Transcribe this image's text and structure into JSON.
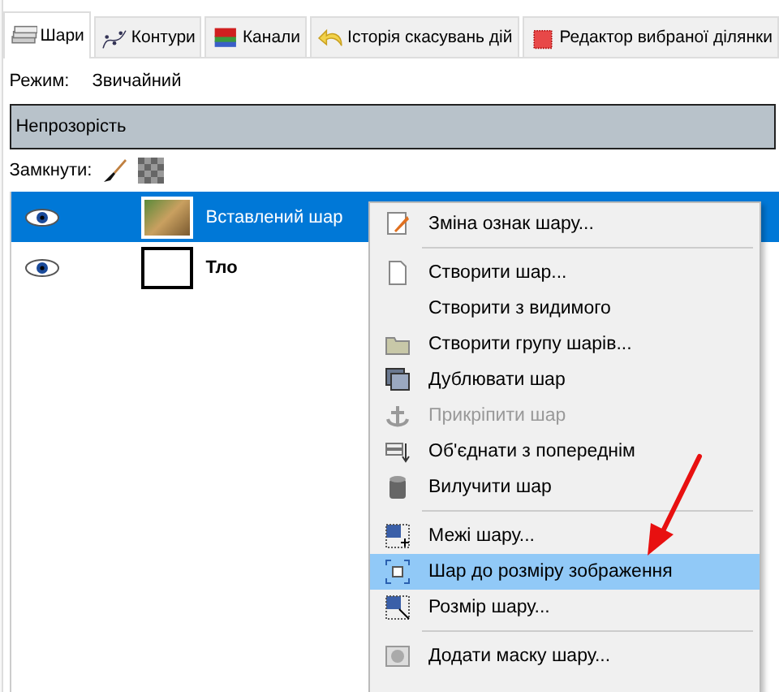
{
  "tabs": [
    {
      "label": "Шари",
      "selected": true
    },
    {
      "label": "Контури",
      "selected": false
    },
    {
      "label": "Канали",
      "selected": false
    },
    {
      "label": "Історія скасувань дій",
      "selected": false
    },
    {
      "label": "Редактор вибраної ділянки",
      "selected": false
    }
  ],
  "mode": {
    "label": "Режим:",
    "value": "Звичайний"
  },
  "opacity": {
    "label": "Непрозорість",
    "level": 1
  },
  "lock": {
    "label": "Замкнути:"
  },
  "layers": [
    {
      "name": "Вставлений шар",
      "visible": true,
      "selected": true
    },
    {
      "name": "Тло",
      "visible": true,
      "selected": false
    }
  ],
  "context_menu": {
    "items": [
      {
        "kind": "item",
        "label": "Зміна ознак шару...",
        "disabled": false,
        "selected": false
      },
      {
        "kind": "separator"
      },
      {
        "kind": "item",
        "label": "Створити шар...",
        "disabled": false,
        "selected": false
      },
      {
        "kind": "item",
        "label": "Створити з видимого",
        "disabled": false,
        "selected": false
      },
      {
        "kind": "item",
        "label": "Створити групу шарів...",
        "disabled": false,
        "selected": false
      },
      {
        "kind": "item",
        "label": "Дублювати шар",
        "disabled": false,
        "selected": false
      },
      {
        "kind": "item",
        "label": "Прикріпити шар",
        "disabled": true,
        "selected": false
      },
      {
        "kind": "item",
        "label": "Об'єднати з попереднім",
        "disabled": false,
        "selected": false
      },
      {
        "kind": "item",
        "label": "Вилучити шар",
        "disabled": false,
        "selected": false
      },
      {
        "kind": "separator"
      },
      {
        "kind": "item",
        "label": "Межі шару...",
        "disabled": false,
        "selected": false
      },
      {
        "kind": "item",
        "label": "Шар до розміру зображення",
        "disabled": false,
        "selected": true
      },
      {
        "kind": "item",
        "label": "Розмір шару...",
        "disabled": false,
        "selected": false
      },
      {
        "kind": "separator"
      },
      {
        "kind": "item",
        "label": "Додати маску шару...",
        "disabled": false,
        "selected": false
      }
    ]
  }
}
